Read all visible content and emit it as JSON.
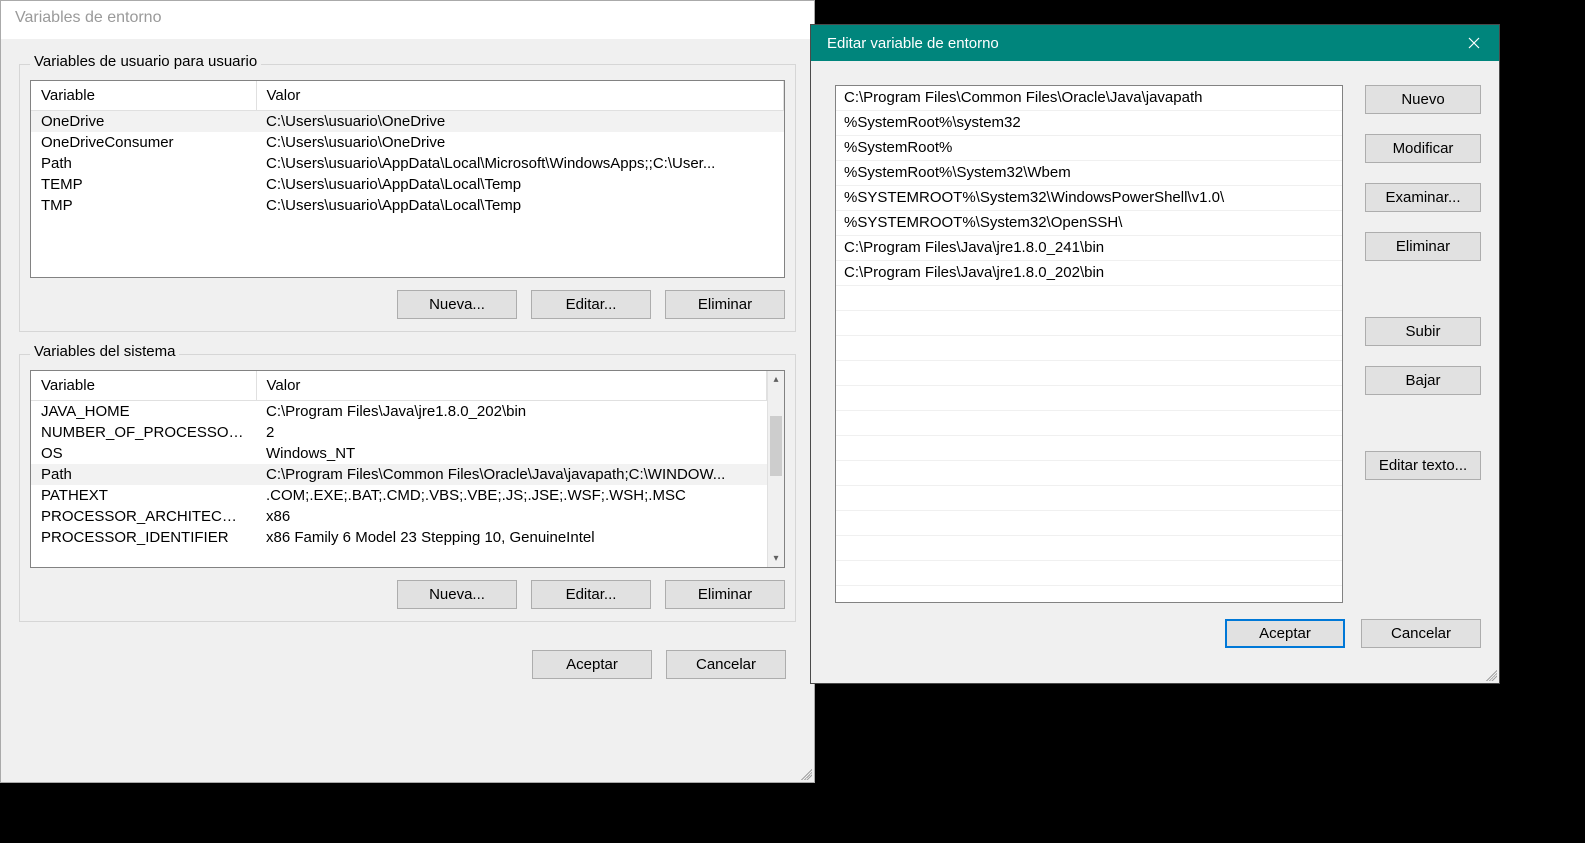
{
  "envDialog": {
    "title": "Variables de entorno",
    "userGroup": {
      "label": "Variables de usuario para usuario",
      "columns": {
        "variable": "Variable",
        "value": "Valor"
      },
      "rows": [
        {
          "variable": "OneDrive",
          "value": "C:\\Users\\usuario\\OneDrive",
          "selected": true
        },
        {
          "variable": "OneDriveConsumer",
          "value": "C:\\Users\\usuario\\OneDrive"
        },
        {
          "variable": "Path",
          "value": "C:\\Users\\usuario\\AppData\\Local\\Microsoft\\WindowsApps;;C:\\User..."
        },
        {
          "variable": "TEMP",
          "value": "C:\\Users\\usuario\\AppData\\Local\\Temp"
        },
        {
          "variable": "TMP",
          "value": "C:\\Users\\usuario\\AppData\\Local\\Temp"
        }
      ],
      "buttons": {
        "new": "Nueva...",
        "edit": "Editar...",
        "delete": "Eliminar"
      }
    },
    "systemGroup": {
      "label": "Variables del sistema",
      "columns": {
        "variable": "Variable",
        "value": "Valor"
      },
      "rows": [
        {
          "variable": "JAVA_HOME",
          "value": "C:\\Program Files\\Java\\jre1.8.0_202\\bin"
        },
        {
          "variable": "NUMBER_OF_PROCESSORS",
          "value": "2"
        },
        {
          "variable": "OS",
          "value": "Windows_NT"
        },
        {
          "variable": "Path",
          "value": "C:\\Program Files\\Common Files\\Oracle\\Java\\javapath;C:\\WINDOW...",
          "selected": true
        },
        {
          "variable": "PATHEXT",
          "value": ".COM;.EXE;.BAT;.CMD;.VBS;.VBE;.JS;.JSE;.WSF;.WSH;.MSC"
        },
        {
          "variable": "PROCESSOR_ARCHITECTURE",
          "value": "x86"
        },
        {
          "variable": "PROCESSOR_IDENTIFIER",
          "value": "x86 Family 6 Model 23 Stepping 10, GenuineIntel"
        }
      ],
      "buttons": {
        "new": "Nueva...",
        "edit": "Editar...",
        "delete": "Eliminar"
      }
    },
    "footer": {
      "ok": "Aceptar",
      "cancel": "Cancelar"
    }
  },
  "editDialog": {
    "title": "Editar variable de entorno",
    "paths": [
      "C:\\Program Files\\Common Files\\Oracle\\Java\\javapath",
      "%SystemRoot%\\system32",
      "%SystemRoot%",
      "%SystemRoot%\\System32\\Wbem",
      "%SYSTEMROOT%\\System32\\WindowsPowerShell\\v1.0\\",
      "%SYSTEMROOT%\\System32\\OpenSSH\\",
      "C:\\Program Files\\Java\\jre1.8.0_241\\bin",
      "C:\\Program Files\\Java\\jre1.8.0_202\\bin"
    ],
    "sideButtons": {
      "new": "Nuevo",
      "edit": "Modificar",
      "browse": "Examinar...",
      "delete": "Eliminar",
      "up": "Subir",
      "down": "Bajar",
      "editText": "Editar texto..."
    },
    "footer": {
      "ok": "Aceptar",
      "cancel": "Cancelar"
    }
  }
}
